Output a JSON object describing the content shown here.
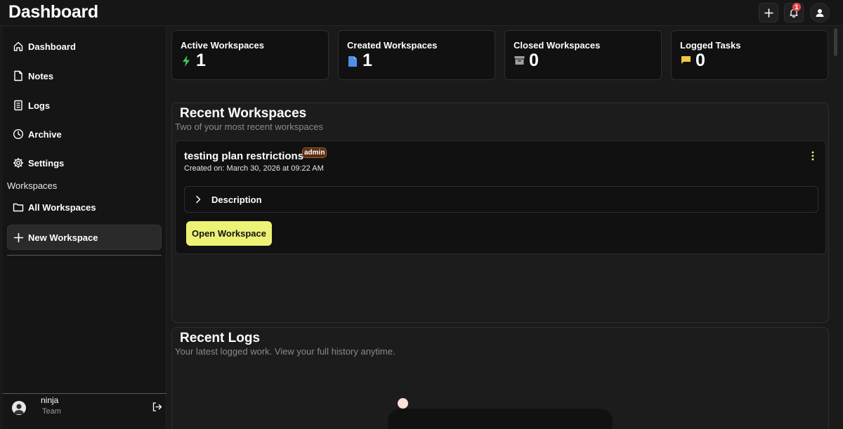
{
  "header": {
    "title": "Dashboard",
    "notification_count": "1"
  },
  "sidebar": {
    "items": [
      {
        "label": "Dashboard",
        "icon": "home-icon"
      },
      {
        "label": "Notes",
        "icon": "note-icon"
      },
      {
        "label": "Logs",
        "icon": "logs-icon"
      },
      {
        "label": "Archive",
        "icon": "clock-icon"
      },
      {
        "label": "Settings",
        "icon": "gear-icon"
      }
    ],
    "section_label": "Workspaces",
    "workspace_items": [
      {
        "label": "All Workspaces",
        "icon": "folder-icon"
      }
    ],
    "new_workspace_label": "New Workspace",
    "user": {
      "name": "ninja",
      "role": "Team"
    }
  },
  "stats": [
    {
      "title": "Active Workspaces",
      "value": "1",
      "icon": "bolt-icon",
      "color": "#3ec75c"
    },
    {
      "title": "Created Workspaces",
      "value": "1",
      "icon": "document-icon",
      "color": "#4f8fe8"
    },
    {
      "title": "Closed Workspaces",
      "value": "0",
      "icon": "archive-box-icon",
      "color": "#a0a0a0"
    },
    {
      "title": "Logged Tasks",
      "value": "0",
      "icon": "flag-icon",
      "color": "#f2c544"
    }
  ],
  "recent_workspaces": {
    "title": "Recent Workspaces",
    "subtitle": "Two of your most recent workspaces",
    "item": {
      "name": "testing plan restrictions",
      "badge": "admin",
      "created": "Created on: March 30, 2026 at 09:22 AM",
      "description_label": "Description",
      "open_label": "Open Workspace"
    }
  },
  "recent_logs": {
    "title": "Recent Logs",
    "subtitle": "Your latest logged work. View your full history anytime."
  },
  "colors": {
    "accent": "#ecf275",
    "badge_bg": "#5a2d14",
    "notification": "#e5484d"
  }
}
